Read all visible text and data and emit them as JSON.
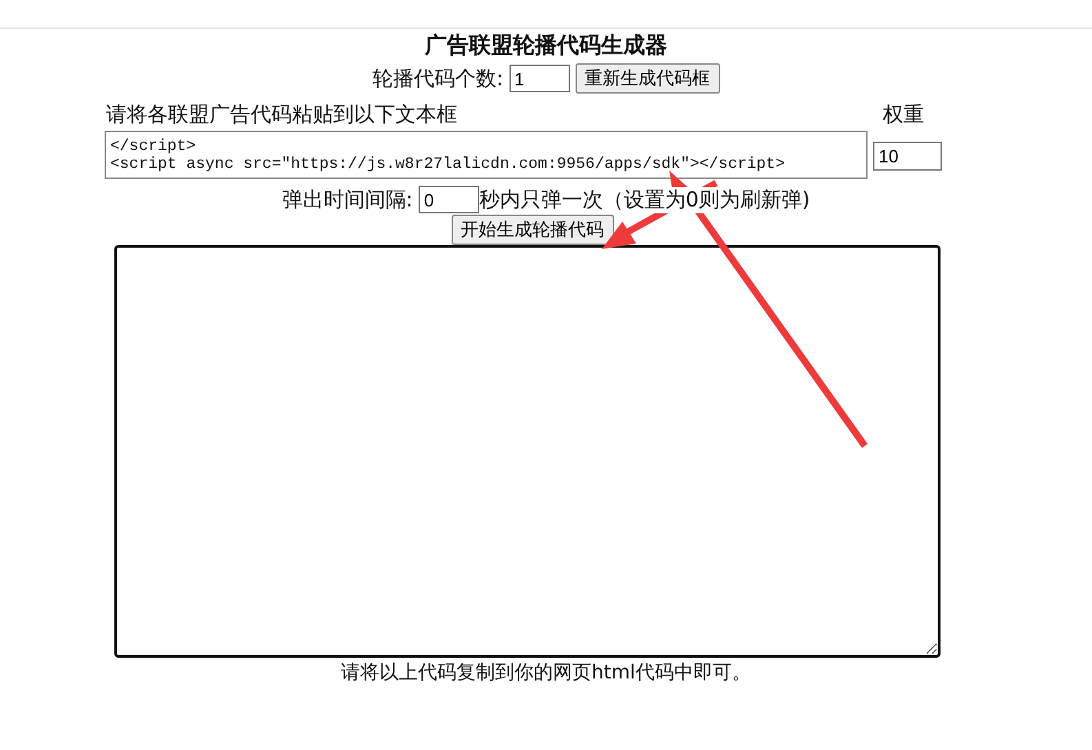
{
  "title": "广告联盟轮播代码生成器",
  "count_row": {
    "label": "轮播代码个数:",
    "value": "1",
    "button": "重新生成代码框"
  },
  "paste_row": {
    "label": "请将各联盟广告代码粘贴到以下文本框",
    "weight_label": "权重"
  },
  "code_inputs": [
    {
      "lines": [
        "</script>",
        "<script async src=\"https://js.w8r27lalicdn.com:9956/apps/sdk\"></script>"
      ],
      "weight": "10"
    }
  ],
  "interval_row": {
    "label": "弹出时间间隔:",
    "value": "0",
    "suffix": "秒内只弹一次（设置为0则为刷新弹)"
  },
  "generate_button": "开始生成轮播代码",
  "footer": "请将以上代码复制到你的网页html代码中即可。"
}
